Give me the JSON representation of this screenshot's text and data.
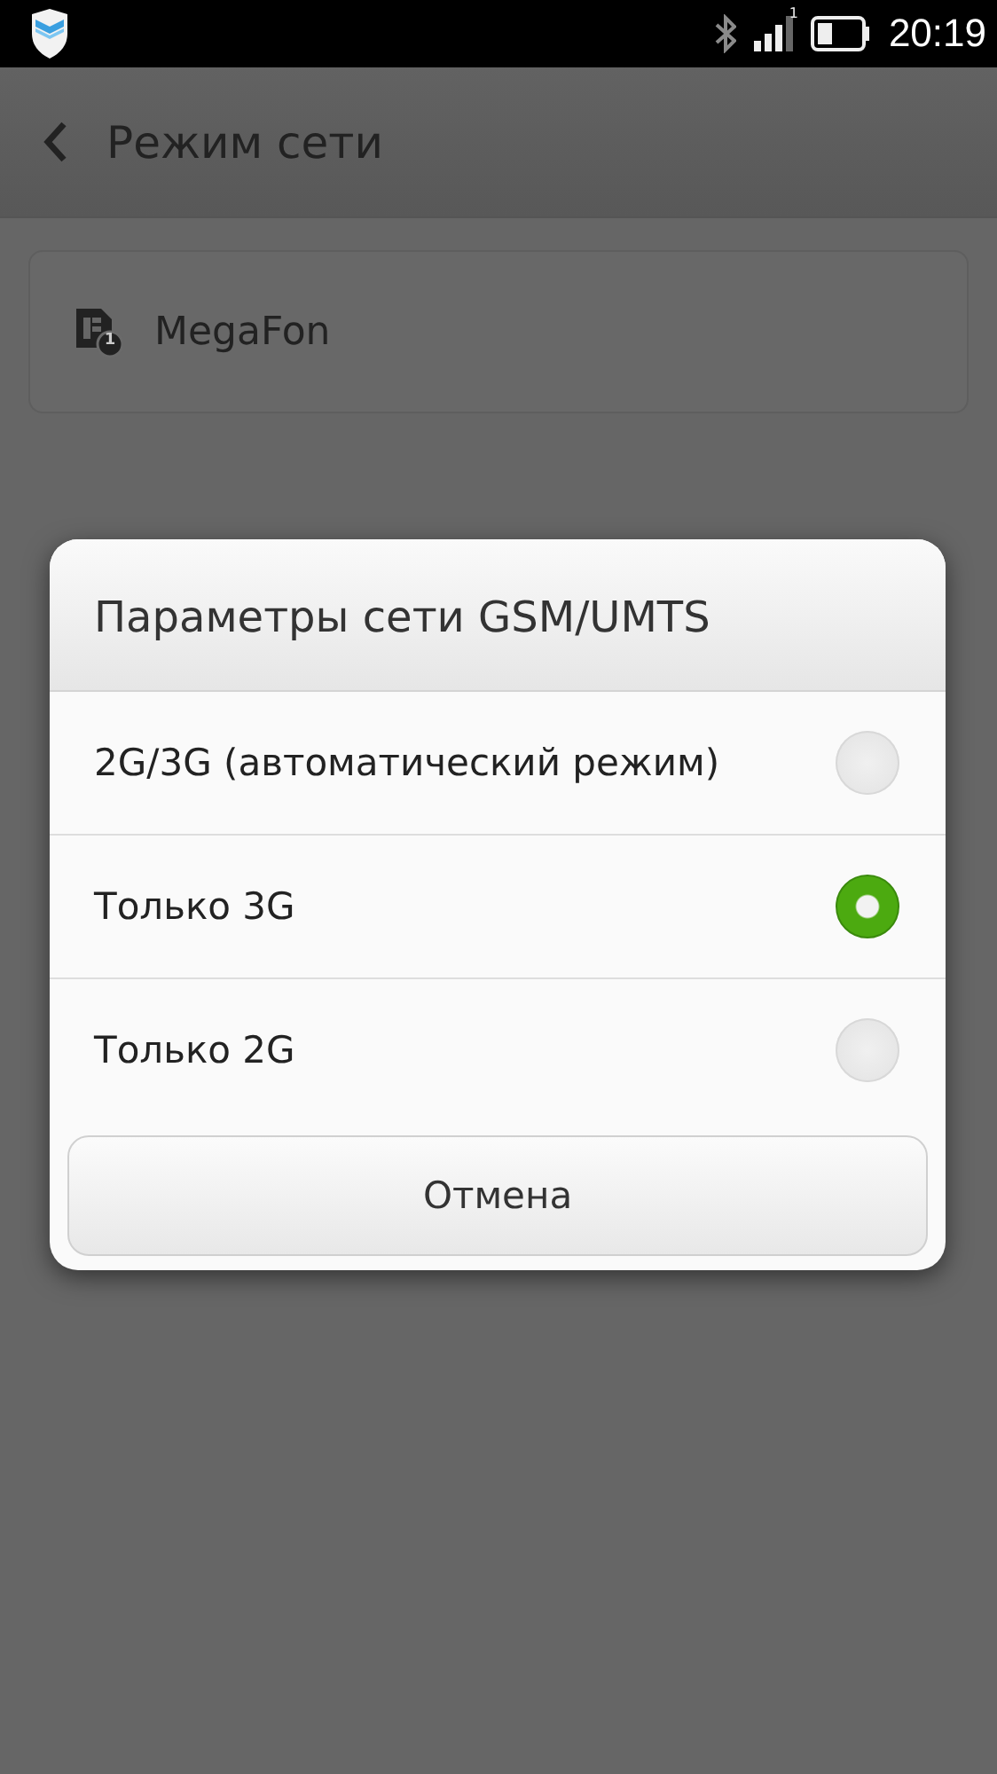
{
  "status_bar": {
    "sim_slot": "1",
    "time": "20:19"
  },
  "header": {
    "title": "Режим сети"
  },
  "sim_card": {
    "label": "MegaFon",
    "slot": "1"
  },
  "dialog": {
    "title": "Параметры сети GSM/UMTS",
    "options": [
      {
        "label": "2G/3G (автоматический режим)",
        "selected": false
      },
      {
        "label": "Только 3G",
        "selected": true
      },
      {
        "label": "Только 2G",
        "selected": false
      }
    ],
    "cancel_button": "Отмена"
  }
}
